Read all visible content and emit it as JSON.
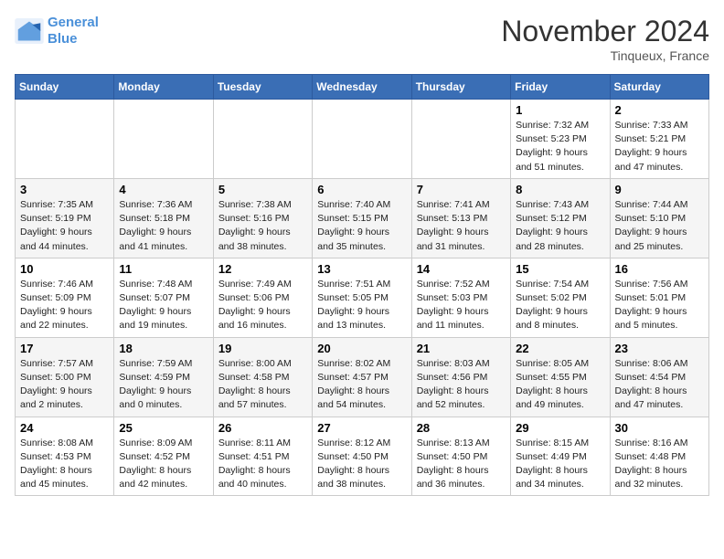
{
  "header": {
    "logo_line1": "General",
    "logo_line2": "Blue",
    "month_title": "November 2024",
    "location": "Tinqueux, France"
  },
  "days_of_week": [
    "Sunday",
    "Monday",
    "Tuesday",
    "Wednesday",
    "Thursday",
    "Friday",
    "Saturday"
  ],
  "weeks": [
    [
      {
        "day": "",
        "info": ""
      },
      {
        "day": "",
        "info": ""
      },
      {
        "day": "",
        "info": ""
      },
      {
        "day": "",
        "info": ""
      },
      {
        "day": "",
        "info": ""
      },
      {
        "day": "1",
        "info": "Sunrise: 7:32 AM\nSunset: 5:23 PM\nDaylight: 9 hours and 51 minutes."
      },
      {
        "day": "2",
        "info": "Sunrise: 7:33 AM\nSunset: 5:21 PM\nDaylight: 9 hours and 47 minutes."
      }
    ],
    [
      {
        "day": "3",
        "info": "Sunrise: 7:35 AM\nSunset: 5:19 PM\nDaylight: 9 hours and 44 minutes."
      },
      {
        "day": "4",
        "info": "Sunrise: 7:36 AM\nSunset: 5:18 PM\nDaylight: 9 hours and 41 minutes."
      },
      {
        "day": "5",
        "info": "Sunrise: 7:38 AM\nSunset: 5:16 PM\nDaylight: 9 hours and 38 minutes."
      },
      {
        "day": "6",
        "info": "Sunrise: 7:40 AM\nSunset: 5:15 PM\nDaylight: 9 hours and 35 minutes."
      },
      {
        "day": "7",
        "info": "Sunrise: 7:41 AM\nSunset: 5:13 PM\nDaylight: 9 hours and 31 minutes."
      },
      {
        "day": "8",
        "info": "Sunrise: 7:43 AM\nSunset: 5:12 PM\nDaylight: 9 hours and 28 minutes."
      },
      {
        "day": "9",
        "info": "Sunrise: 7:44 AM\nSunset: 5:10 PM\nDaylight: 9 hours and 25 minutes."
      }
    ],
    [
      {
        "day": "10",
        "info": "Sunrise: 7:46 AM\nSunset: 5:09 PM\nDaylight: 9 hours and 22 minutes."
      },
      {
        "day": "11",
        "info": "Sunrise: 7:48 AM\nSunset: 5:07 PM\nDaylight: 9 hours and 19 minutes."
      },
      {
        "day": "12",
        "info": "Sunrise: 7:49 AM\nSunset: 5:06 PM\nDaylight: 9 hours and 16 minutes."
      },
      {
        "day": "13",
        "info": "Sunrise: 7:51 AM\nSunset: 5:05 PM\nDaylight: 9 hours and 13 minutes."
      },
      {
        "day": "14",
        "info": "Sunrise: 7:52 AM\nSunset: 5:03 PM\nDaylight: 9 hours and 11 minutes."
      },
      {
        "day": "15",
        "info": "Sunrise: 7:54 AM\nSunset: 5:02 PM\nDaylight: 9 hours and 8 minutes."
      },
      {
        "day": "16",
        "info": "Sunrise: 7:56 AM\nSunset: 5:01 PM\nDaylight: 9 hours and 5 minutes."
      }
    ],
    [
      {
        "day": "17",
        "info": "Sunrise: 7:57 AM\nSunset: 5:00 PM\nDaylight: 9 hours and 2 minutes."
      },
      {
        "day": "18",
        "info": "Sunrise: 7:59 AM\nSunset: 4:59 PM\nDaylight: 9 hours and 0 minutes."
      },
      {
        "day": "19",
        "info": "Sunrise: 8:00 AM\nSunset: 4:58 PM\nDaylight: 8 hours and 57 minutes."
      },
      {
        "day": "20",
        "info": "Sunrise: 8:02 AM\nSunset: 4:57 PM\nDaylight: 8 hours and 54 minutes."
      },
      {
        "day": "21",
        "info": "Sunrise: 8:03 AM\nSunset: 4:56 PM\nDaylight: 8 hours and 52 minutes."
      },
      {
        "day": "22",
        "info": "Sunrise: 8:05 AM\nSunset: 4:55 PM\nDaylight: 8 hours and 49 minutes."
      },
      {
        "day": "23",
        "info": "Sunrise: 8:06 AM\nSunset: 4:54 PM\nDaylight: 8 hours and 47 minutes."
      }
    ],
    [
      {
        "day": "24",
        "info": "Sunrise: 8:08 AM\nSunset: 4:53 PM\nDaylight: 8 hours and 45 minutes."
      },
      {
        "day": "25",
        "info": "Sunrise: 8:09 AM\nSunset: 4:52 PM\nDaylight: 8 hours and 42 minutes."
      },
      {
        "day": "26",
        "info": "Sunrise: 8:11 AM\nSunset: 4:51 PM\nDaylight: 8 hours and 40 minutes."
      },
      {
        "day": "27",
        "info": "Sunrise: 8:12 AM\nSunset: 4:50 PM\nDaylight: 8 hours and 38 minutes."
      },
      {
        "day": "28",
        "info": "Sunrise: 8:13 AM\nSunset: 4:50 PM\nDaylight: 8 hours and 36 minutes."
      },
      {
        "day": "29",
        "info": "Sunrise: 8:15 AM\nSunset: 4:49 PM\nDaylight: 8 hours and 34 minutes."
      },
      {
        "day": "30",
        "info": "Sunrise: 8:16 AM\nSunset: 4:48 PM\nDaylight: 8 hours and 32 minutes."
      }
    ]
  ]
}
